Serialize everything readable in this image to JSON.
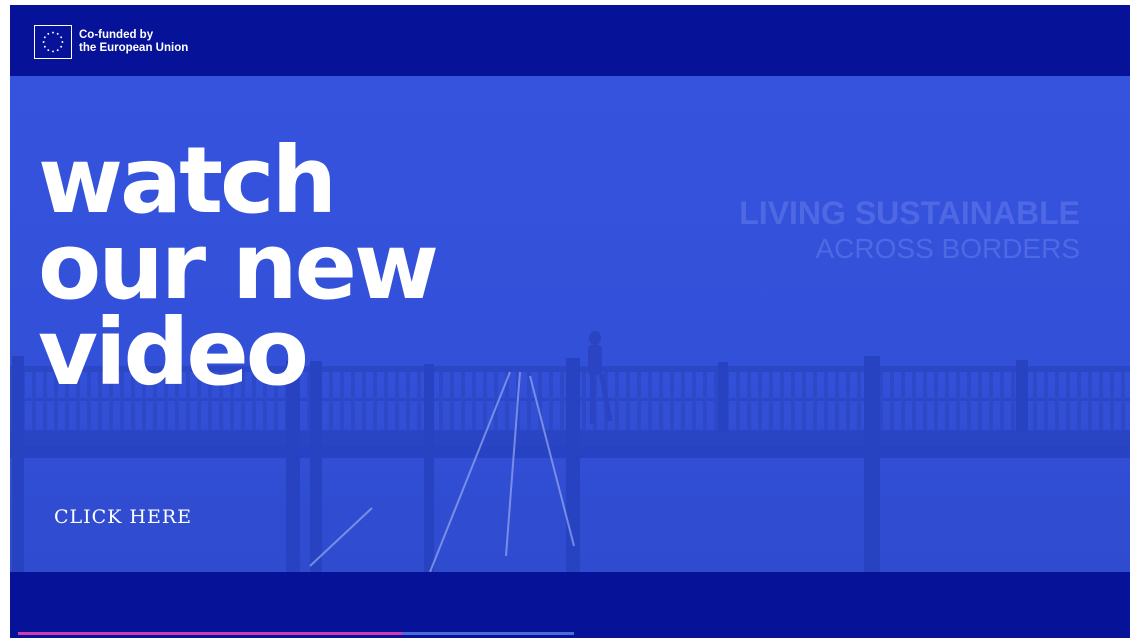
{
  "logo": {
    "line1": "Co-funded by",
    "line2": "the European Union",
    "icon": "eu-flag-icon"
  },
  "headline": {
    "line1": "watch",
    "line2": "our new",
    "line3": "video"
  },
  "cta": {
    "label": "CLICK HERE"
  },
  "brand": {
    "line1": "LIVING SUSTAINABLE",
    "line2": "ACROSS BORDERS"
  },
  "player": {
    "progress_fraction": 0.69
  },
  "colors": {
    "bar": "#061398",
    "overlay": "#3553dd",
    "progress": "#d43ab0",
    "track": "#4d6bd8"
  }
}
